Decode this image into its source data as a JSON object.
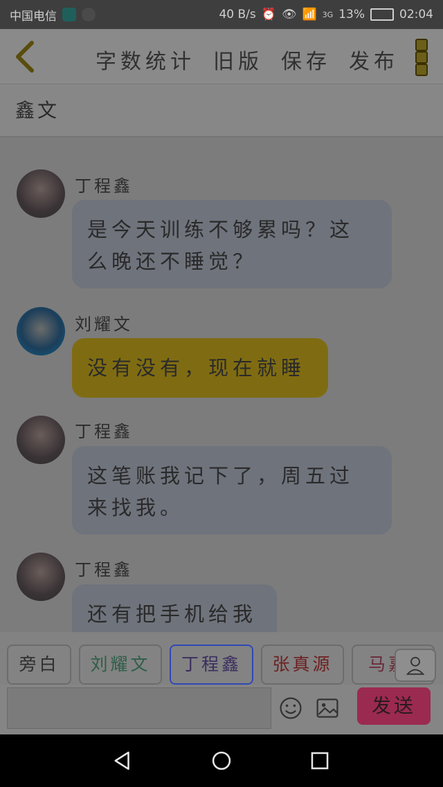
{
  "status_bar": {
    "carrier": "中国电信",
    "network_speed": "40 B/s",
    "signal": "3G",
    "battery": "13%",
    "time": "02:04"
  },
  "top_bar": {
    "actions": [
      "字数统计",
      "旧版",
      "保存",
      "发布"
    ]
  },
  "title": "鑫文",
  "messages": [
    {
      "name": "丁程鑫",
      "text_lines": [
        "是今天训练不够累吗？这",
        "么晚还不睡觉？"
      ],
      "is_me": false
    },
    {
      "name": "刘耀文",
      "text_lines": [
        "没有没有，现在就睡"
      ],
      "is_me": true
    },
    {
      "name": "丁程鑫",
      "text_lines": [
        "这笔账我记下了，周五过",
        "来找我。"
      ],
      "is_me": false
    },
    {
      "name": "丁程鑫",
      "text_lines": [
        "还有把手机给我"
      ],
      "is_me": false
    }
  ],
  "characters": [
    "旁白",
    "刘耀文",
    "丁程鑫",
    "张真源",
    "马嘉祺"
  ],
  "send_label": "发送",
  "colors": {
    "accent_yellow": "#7f6c12",
    "send_button": "#9b2a50",
    "selected_chip_border": "#2f48b5"
  }
}
